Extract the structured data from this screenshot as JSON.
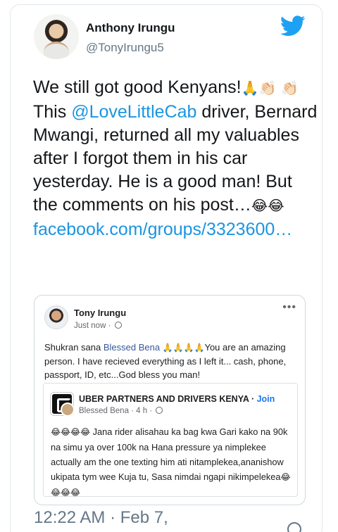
{
  "tweet": {
    "display_name": "Anthony Irungu",
    "handle": "@TonyIrungu5",
    "text_1": "We still got good Kenyans!",
    "emoji_1": "🙏👏🏻",
    "emoji_2": "👏🏻",
    "text_2": " This ",
    "mention": "@LoveLittleCab",
    "text_3": " driver, Bernard Mwangi, returned all my valuables after I forgot them in his car yesterday. He is a good man! But the comments on his post…",
    "emoji_3": "😂😂",
    "link": "facebook.com/groups/3323600…",
    "timestamp": "12:22 AM · Feb 7,"
  },
  "quoted_post": {
    "author": "Tony Irungu",
    "meta": "Just now · ",
    "more": "•••",
    "text_1": "Shukran sana ",
    "tagged": "Blessed Bena",
    "prayers": "🙏🙏🙏🙏",
    "text_2": "You are an amazing person. I have recieved everything as I left it... cash, phone, passport, ID, etc...God bless you man!",
    "shared": {
      "group_name": "UBER PARTNERS AND DRIVERS KENYA",
      "join_label": "Join",
      "meta": "Blessed Bena · 4 h · ",
      "laugh_1": "😂😂😂😂",
      "text": " Jana rider alisahau ka bag kwa Gari kako na 90k na simu ya over 100k na Hana pressure ya nimplekee actually am the one texting him ati nitamplekea,ananishow ukipata tym wee Kuja tu, Sasa nimdai ngapi nikimpelekea",
      "laugh_2": "😂😂😂😂"
    }
  },
  "colors": {
    "accent": "#1b95e0",
    "secondary_text": "#657786",
    "facebook_link": "#385898"
  },
  "icons": [
    "twitter-logo-icon",
    "globe-icon",
    "more-options-icon"
  ]
}
